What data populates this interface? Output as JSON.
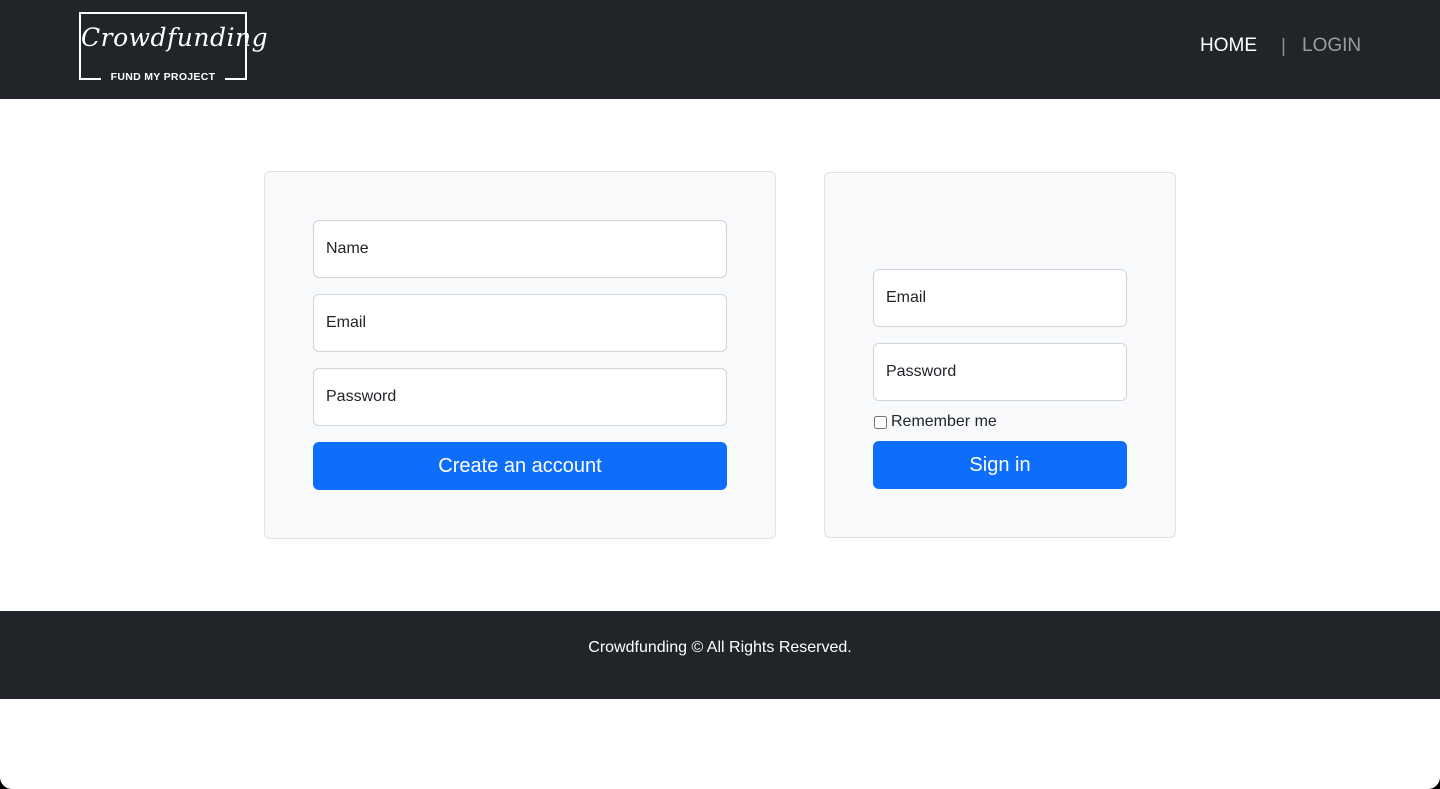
{
  "header": {
    "logo": {
      "script_text": "Crowdfunding",
      "tagline": "FUND MY PROJECT"
    },
    "nav": {
      "home": "HOME",
      "separator": "|",
      "login": "LOGIN"
    }
  },
  "register_form": {
    "name_placeholder": "Name",
    "email_placeholder": "Email",
    "password_placeholder": "Password",
    "submit_label": "Create an account"
  },
  "login_form": {
    "email_placeholder": "Email",
    "password_placeholder": "Password",
    "remember_label": "Remember me",
    "remember_checked": false,
    "submit_label": "Sign in"
  },
  "footer": {
    "text": "Crowdfunding © All Rights Reserved."
  },
  "colors": {
    "navbar_bg": "#212529",
    "card_bg": "#f8f9fa",
    "primary": "#0d6efd"
  }
}
